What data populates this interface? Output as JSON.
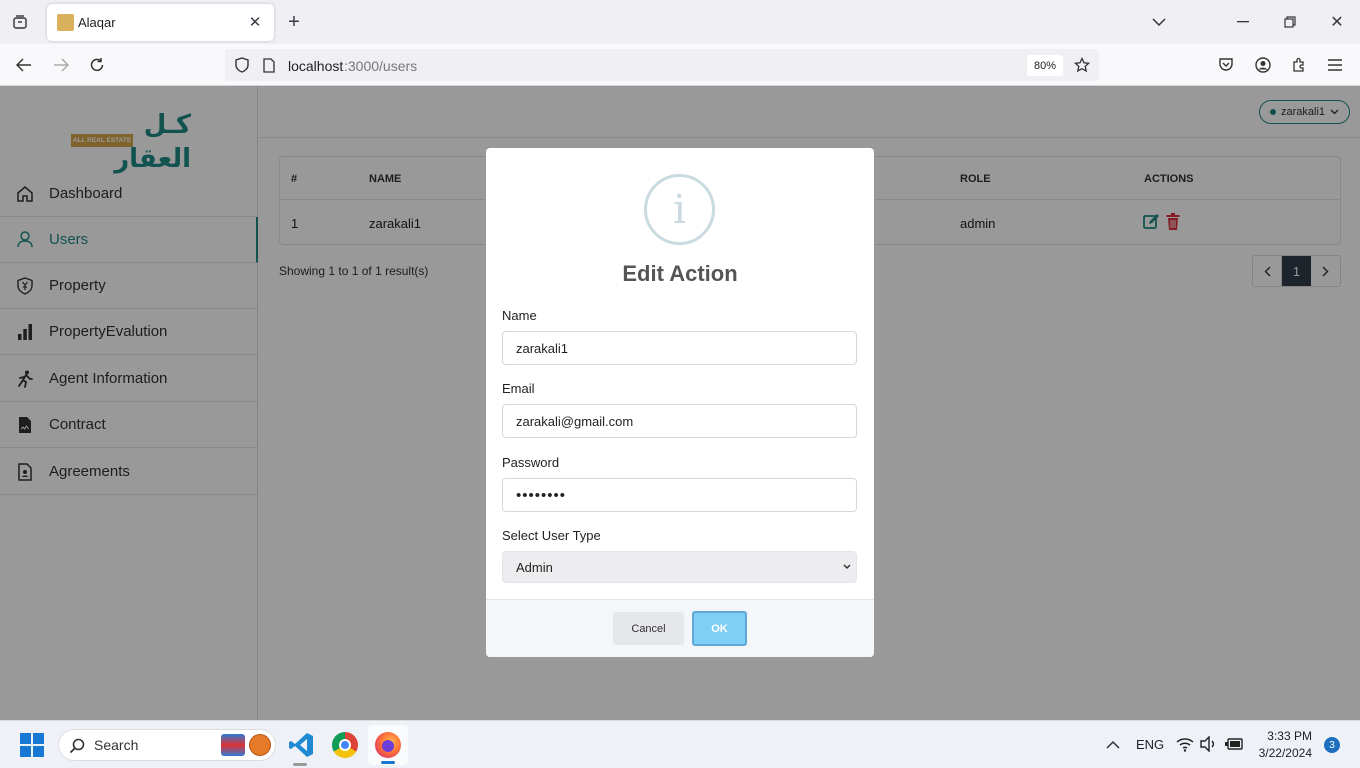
{
  "browser": {
    "tab_title": "Alaqar",
    "url_host": "localhost",
    "url_path": ":3000/users",
    "zoom": "80%",
    "icons": [
      "tab-list-icon",
      "close-icon",
      "plus-icon",
      "chevron-down-icon",
      "minimize-icon",
      "maximize-icon",
      "back-icon",
      "forward-icon",
      "reload-icon",
      "shield-icon",
      "page-icon",
      "star-icon",
      "pocket-icon",
      "account-icon",
      "extensions-icon",
      "menu-icon"
    ]
  },
  "brand": {
    "logo_text": "كـل العقار",
    "logo_subtext": "ALL REAL ESTATE"
  },
  "sidebar": {
    "items": [
      {
        "label": "Dashboard",
        "icon": "home-icon"
      },
      {
        "label": "Users",
        "icon": "user-icon"
      },
      {
        "label": "Property",
        "icon": "property-icon"
      },
      {
        "label": "PropertyEvalution",
        "icon": "bar-chart-icon"
      },
      {
        "label": "Agent Information",
        "icon": "agent-icon"
      },
      {
        "label": "Contract",
        "icon": "contract-icon"
      },
      {
        "label": "Agreements",
        "icon": "agreement-icon"
      }
    ]
  },
  "header": {
    "user": "zarakali1"
  },
  "table": {
    "columns": [
      "#",
      "NAME",
      "ROLE",
      "ACTIONS"
    ],
    "rows": [
      {
        "index": "1",
        "name": "zarakali1",
        "role": "admin"
      }
    ],
    "summary": "Showing 1 to 1 of 1 result(s)",
    "current_page": "1"
  },
  "modal": {
    "title": "Edit Action",
    "icon_glyph": "i",
    "name_label": "Name",
    "name_value": "zarakali1",
    "email_label": "Email",
    "email_value": "zarakali@gmail.com",
    "password_label": "Password",
    "password_value": "••••••••",
    "type_label": "Select User Type",
    "type_value": "Admin",
    "cancel_label": "Cancel",
    "ok_label": "OK"
  },
  "taskbar": {
    "search_placeholder": "Search",
    "lang": "ENG",
    "time": "3:33 PM",
    "date": "3/22/2024",
    "notifications": "3"
  },
  "colors": {
    "accent": "#1e8a85",
    "ok_button": "#7ecff3",
    "delete": "#e0303a",
    "overlay": "rgba(0,0,0,0.4)"
  }
}
